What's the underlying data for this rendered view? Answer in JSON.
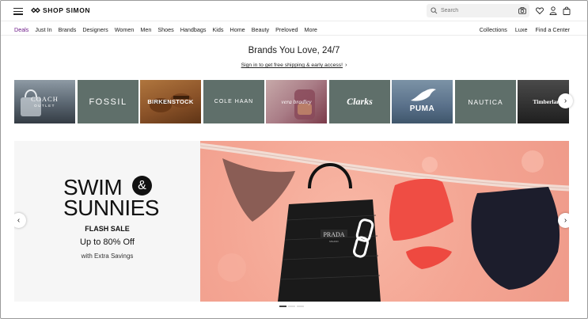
{
  "header": {
    "logo_text": "SHOP SIMON",
    "search_placeholder": "Search",
    "icons": [
      "menu-icon",
      "search-icon",
      "camera-icon",
      "heart-icon",
      "user-icon",
      "bag-icon"
    ]
  },
  "nav": {
    "left": [
      "Deals",
      "Just In",
      "Brands",
      "Designers",
      "Women",
      "Men",
      "Shoes",
      "Handbags",
      "Kids",
      "Home",
      "Beauty",
      "Preloved",
      "More"
    ],
    "right": [
      "Collections",
      "Luxe",
      "Find a Center"
    ],
    "active": "Deals"
  },
  "promo": {
    "title": "Brands You Love, 24/7",
    "link": "Sign in to get free shipping & early access!"
  },
  "brands": [
    {
      "name": "COACH",
      "sub": "OUTLET"
    },
    {
      "name": "FOSSIL"
    },
    {
      "name": "BIRKENSTOCK"
    },
    {
      "name": "COLE HAAN"
    },
    {
      "name": "vera bradley"
    },
    {
      "name": "Clarks"
    },
    {
      "name": "PUMA"
    },
    {
      "name": "NAUTICA"
    },
    {
      "name": "Timberland"
    }
  ],
  "hero": {
    "line1": "SWIM",
    "amp": "&",
    "line2": "SUNNIES",
    "flash": "FLASH SALE",
    "upto": "Up to 80% Off",
    "extra": "with Extra Savings",
    "bag_brand": "PRADA",
    "bag_sub": "MILANO",
    "slides": 3,
    "active_slide": 1
  },
  "colors": {
    "accent_active_nav": "#6f1d8a",
    "tile_grey": "#5f6f6a",
    "hero_bg": "#f4a593"
  }
}
